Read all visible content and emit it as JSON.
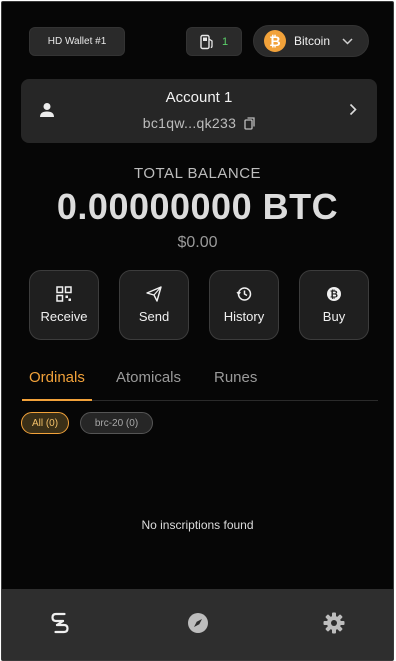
{
  "header": {
    "wallet_label": "HD Wallet #1",
    "fuel_count": "1",
    "network_label": "Bitcoin",
    "network_symbol": "₿"
  },
  "account": {
    "title": "Account 1",
    "address": "bc1qw...qk233"
  },
  "balance": {
    "label": "TOTAL BALANCE",
    "amount": "0.00000000 BTC",
    "usd": "$0.00"
  },
  "actions": [
    {
      "label": "Receive",
      "icon": "qr-icon"
    },
    {
      "label": "Send",
      "icon": "send-icon"
    },
    {
      "label": "History",
      "icon": "history-icon"
    },
    {
      "label": "Buy",
      "icon": "bitcoin-icon"
    }
  ],
  "tabs": [
    {
      "label": "Ordinals",
      "active": true
    },
    {
      "label": "Atomicals",
      "active": false
    },
    {
      "label": "Runes",
      "active": false
    }
  ],
  "filters": [
    {
      "label": "All (0)",
      "active": true
    },
    {
      "label": "brc-20 (0)",
      "active": false
    }
  ],
  "empty_message": "No inscriptions found",
  "nav": [
    "wallet-icon",
    "explore-icon",
    "settings-icon"
  ],
  "colors": {
    "accent": "#f2a23a",
    "background": "#060606",
    "success": "#5bd16a"
  }
}
